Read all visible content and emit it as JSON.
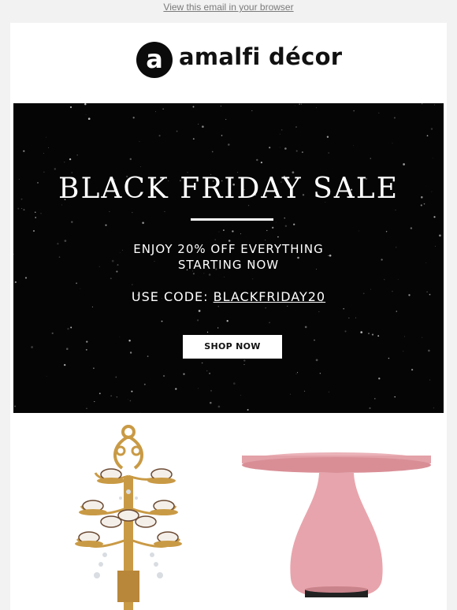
{
  "topbar": {
    "view_in_browser": "View this email in your browser"
  },
  "brand": {
    "logo_letter": "a",
    "name": "amalfi décor"
  },
  "hero": {
    "title": "BLACK FRIDAY SALE",
    "line1": "ENJOY 20% OFF EVERYTHING",
    "line2": "STARTING NOW",
    "code_label": "USE CODE: ",
    "code": "BLACKFRIDAY20",
    "cta": "SHOP NOW"
  },
  "products": [
    {
      "image": "gold-cupcake-chandelier-stand-image"
    },
    {
      "image": "pink-cake-stand-image"
    }
  ],
  "colors": {
    "page_bg": "#f2f2f2",
    "hero_bg": "#050505",
    "gold": "#c99a45",
    "pink": "#e8a4ac"
  }
}
